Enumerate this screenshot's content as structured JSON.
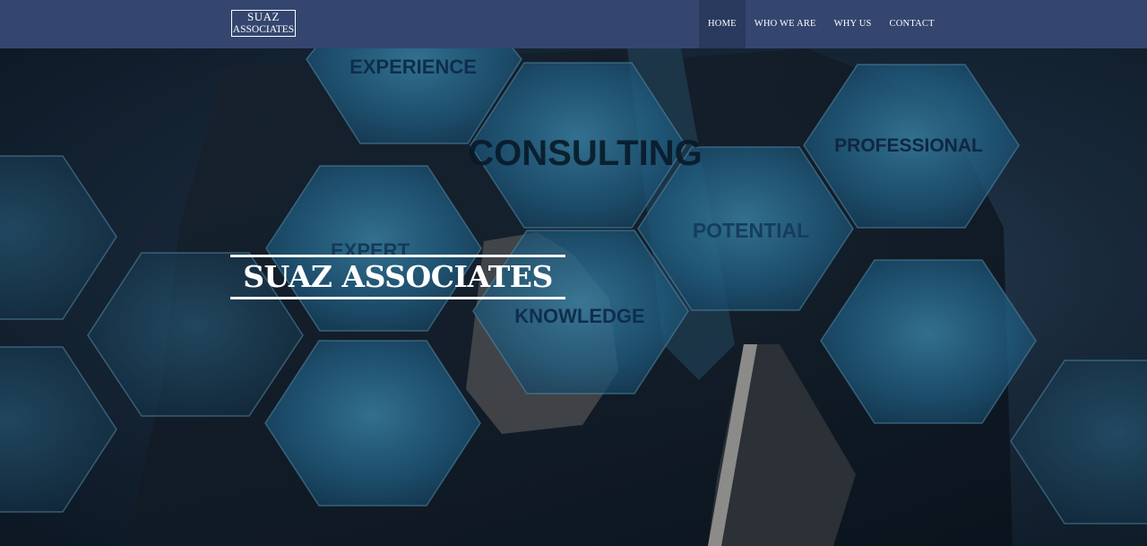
{
  "brand": {
    "logo_line1": "SUAZ",
    "logo_line2": "ASSOCIATES"
  },
  "nav": {
    "items": [
      {
        "label": "HOME",
        "active": true
      },
      {
        "label": "WHO WE ARE",
        "active": false
      },
      {
        "label": "WHY US",
        "active": false
      },
      {
        "label": "CONTACT",
        "active": false
      }
    ]
  },
  "hero": {
    "title": "SUAZ ASSOCIATES",
    "image_words": {
      "experience": "EXPERIENCE",
      "consulting": "CONSULTING",
      "professional": "PROFESSIONAL",
      "potential": "POTENTIAL",
      "expert": "EXPERT",
      "knowledge": "KNOWLEDGE"
    }
  },
  "colors": {
    "navbar": "#34466f",
    "nav_active": "#2a3a5e",
    "hex_fill": "#2d7da8"
  }
}
